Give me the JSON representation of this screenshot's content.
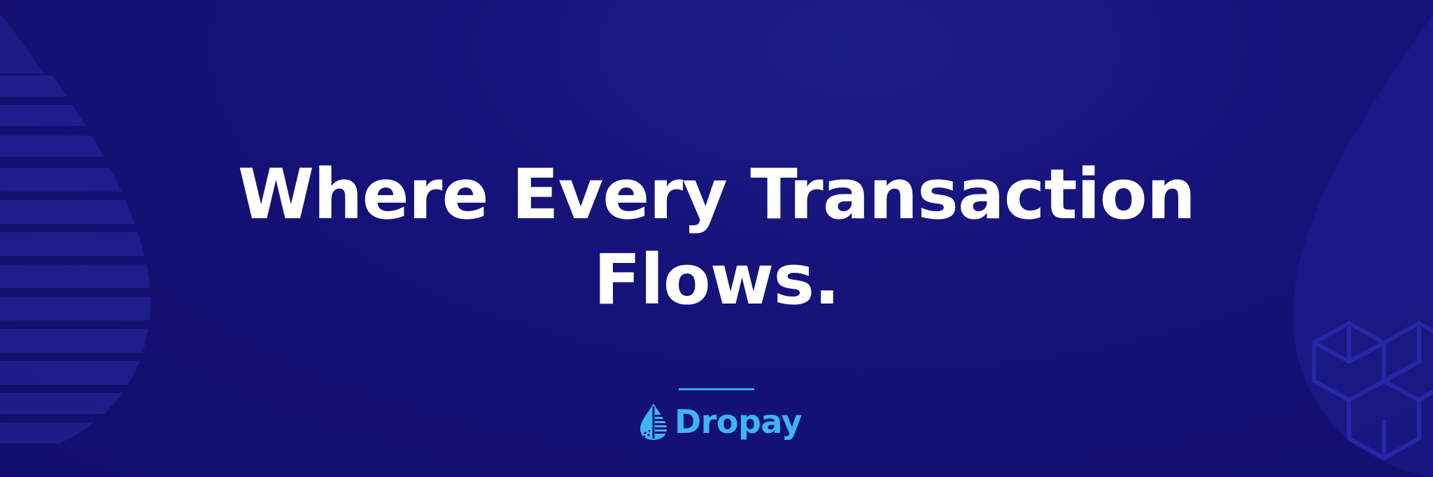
{
  "banner": {
    "headline_line1": "Where Every Transaction",
    "headline_line2": "Flows.",
    "brand_name": "Dropay"
  },
  "colors": {
    "background": "#13107a",
    "headline": "#ffffff",
    "accent": "#3fb4f1"
  },
  "icons": {
    "logo": "water-drop-logo-icon",
    "left_decoration": "striped-drop-icon",
    "right_decoration": "drop-cube-pattern-icon"
  }
}
